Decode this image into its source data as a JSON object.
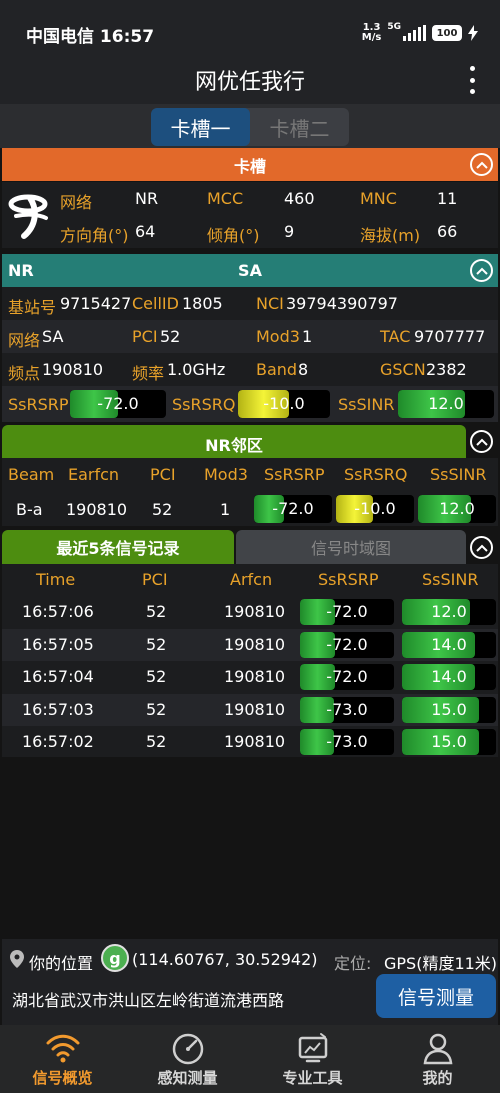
{
  "status_bar": {
    "carrier_time": "中国电信 16:57",
    "speed_value": "1.3",
    "speed_unit": "M/s",
    "network": "5G",
    "battery": "100"
  },
  "app": {
    "title": "网优任我行"
  },
  "sim_tabs": [
    "卡槽一",
    "卡槽二"
  ],
  "sim_section": {
    "header": "卡槽",
    "row1": {
      "l1": "网络",
      "v1": "NR",
      "l2": "MCC",
      "v2": "460",
      "l3": "MNC",
      "v3": "11"
    },
    "row2": {
      "l1": "方向角(°)",
      "v1": "64",
      "l2": "倾角(°)",
      "v2": "9",
      "l3": "海拔(m)",
      "v3": "66"
    }
  },
  "nr_section": {
    "left_title": "NR",
    "title": "SA",
    "row1": {
      "l1": "基站号",
      "v1": "9715427",
      "l2": "CellID",
      "v2": "1805",
      "l3": "NCI",
      "v3": "39794390797"
    },
    "row2": {
      "l1": "网络",
      "v1": "SA",
      "l2": "PCI",
      "v2": "52",
      "l3": "Mod3",
      "v3": "1",
      "l4": "TAC",
      "v4": "9707777"
    },
    "row3": {
      "l1": "频点",
      "v1": "190810",
      "l2": "频率",
      "v2": "1.0GHz",
      "l3": "Band",
      "v3": "8",
      "l4": "GSCN",
      "v4": "2382"
    },
    "gauges": [
      {
        "label": "SsRSRP",
        "value": "-72.0",
        "level": 0.5,
        "color": "green"
      },
      {
        "label": "SsRSRQ",
        "value": "-10.0",
        "level": 0.55,
        "color": "yellow"
      },
      {
        "label": "SsSINR",
        "value": "12.0",
        "level": 0.7,
        "color": "green"
      }
    ]
  },
  "nr_neighbor": {
    "header": "NR邻区",
    "columns": [
      "Beam",
      "Earfcn",
      "PCI",
      "Mod3",
      "SsRSRP",
      "SsRSRQ",
      "SsSINR"
    ],
    "rows": [
      {
        "beam": "B-a",
        "earfcn": "190810",
        "pci": "52",
        "mod3": "1",
        "rsrp": "-72.0",
        "rsrp_level": 0.38,
        "rsrq": "-10.0",
        "rsrq_level": 0.48,
        "sinr": "12.0",
        "sinr_level": 0.68
      }
    ]
  },
  "records": {
    "tabs": [
      "最近5条信号记录",
      "信号时域图"
    ],
    "columns": [
      "Time",
      "PCI",
      "Arfcn",
      "SsRSRP",
      "SsSINR"
    ],
    "rows": [
      {
        "time": "16:57:06",
        "pci": "52",
        "arfcn": "190810",
        "rsrp": "-72.0",
        "rsrp_level": 0.37,
        "sinr": "12.0",
        "sinr_level": 0.72
      },
      {
        "time": "16:57:05",
        "pci": "52",
        "arfcn": "190810",
        "rsrp": "-72.0",
        "rsrp_level": 0.37,
        "sinr": "14.0",
        "sinr_level": 0.78
      },
      {
        "time": "16:57:04",
        "pci": "52",
        "arfcn": "190810",
        "rsrp": "-72.0",
        "rsrp_level": 0.37,
        "sinr": "14.0",
        "sinr_level": 0.78
      },
      {
        "time": "16:57:03",
        "pci": "52",
        "arfcn": "190810",
        "rsrp": "-73.0",
        "rsrp_level": 0.36,
        "sinr": "15.0",
        "sinr_level": 0.82
      },
      {
        "time": "16:57:02",
        "pci": "52",
        "arfcn": "190810",
        "rsrp": "-73.0",
        "rsrp_level": 0.36,
        "sinr": "15.0",
        "sinr_level": 0.82
      }
    ]
  },
  "location": {
    "label": "你的位置",
    "map_icon_letter": "g",
    "coords": "(114.60767, 30.52942)",
    "positioning_label": "定位:",
    "positioning_value": "GPS(精度11米)",
    "address": "湖北省武汉市洪山区左岭街道流港西路",
    "measure_button": "信号测量"
  },
  "bottom_nav": [
    {
      "label": "信号概览",
      "icon": "wifi-icon",
      "active": true
    },
    {
      "label": "感知测量",
      "icon": "gauge-icon",
      "active": false
    },
    {
      "label": "专业工具",
      "icon": "tools-icon",
      "active": false
    },
    {
      "label": "我的",
      "icon": "user-icon",
      "active": false
    }
  ]
}
